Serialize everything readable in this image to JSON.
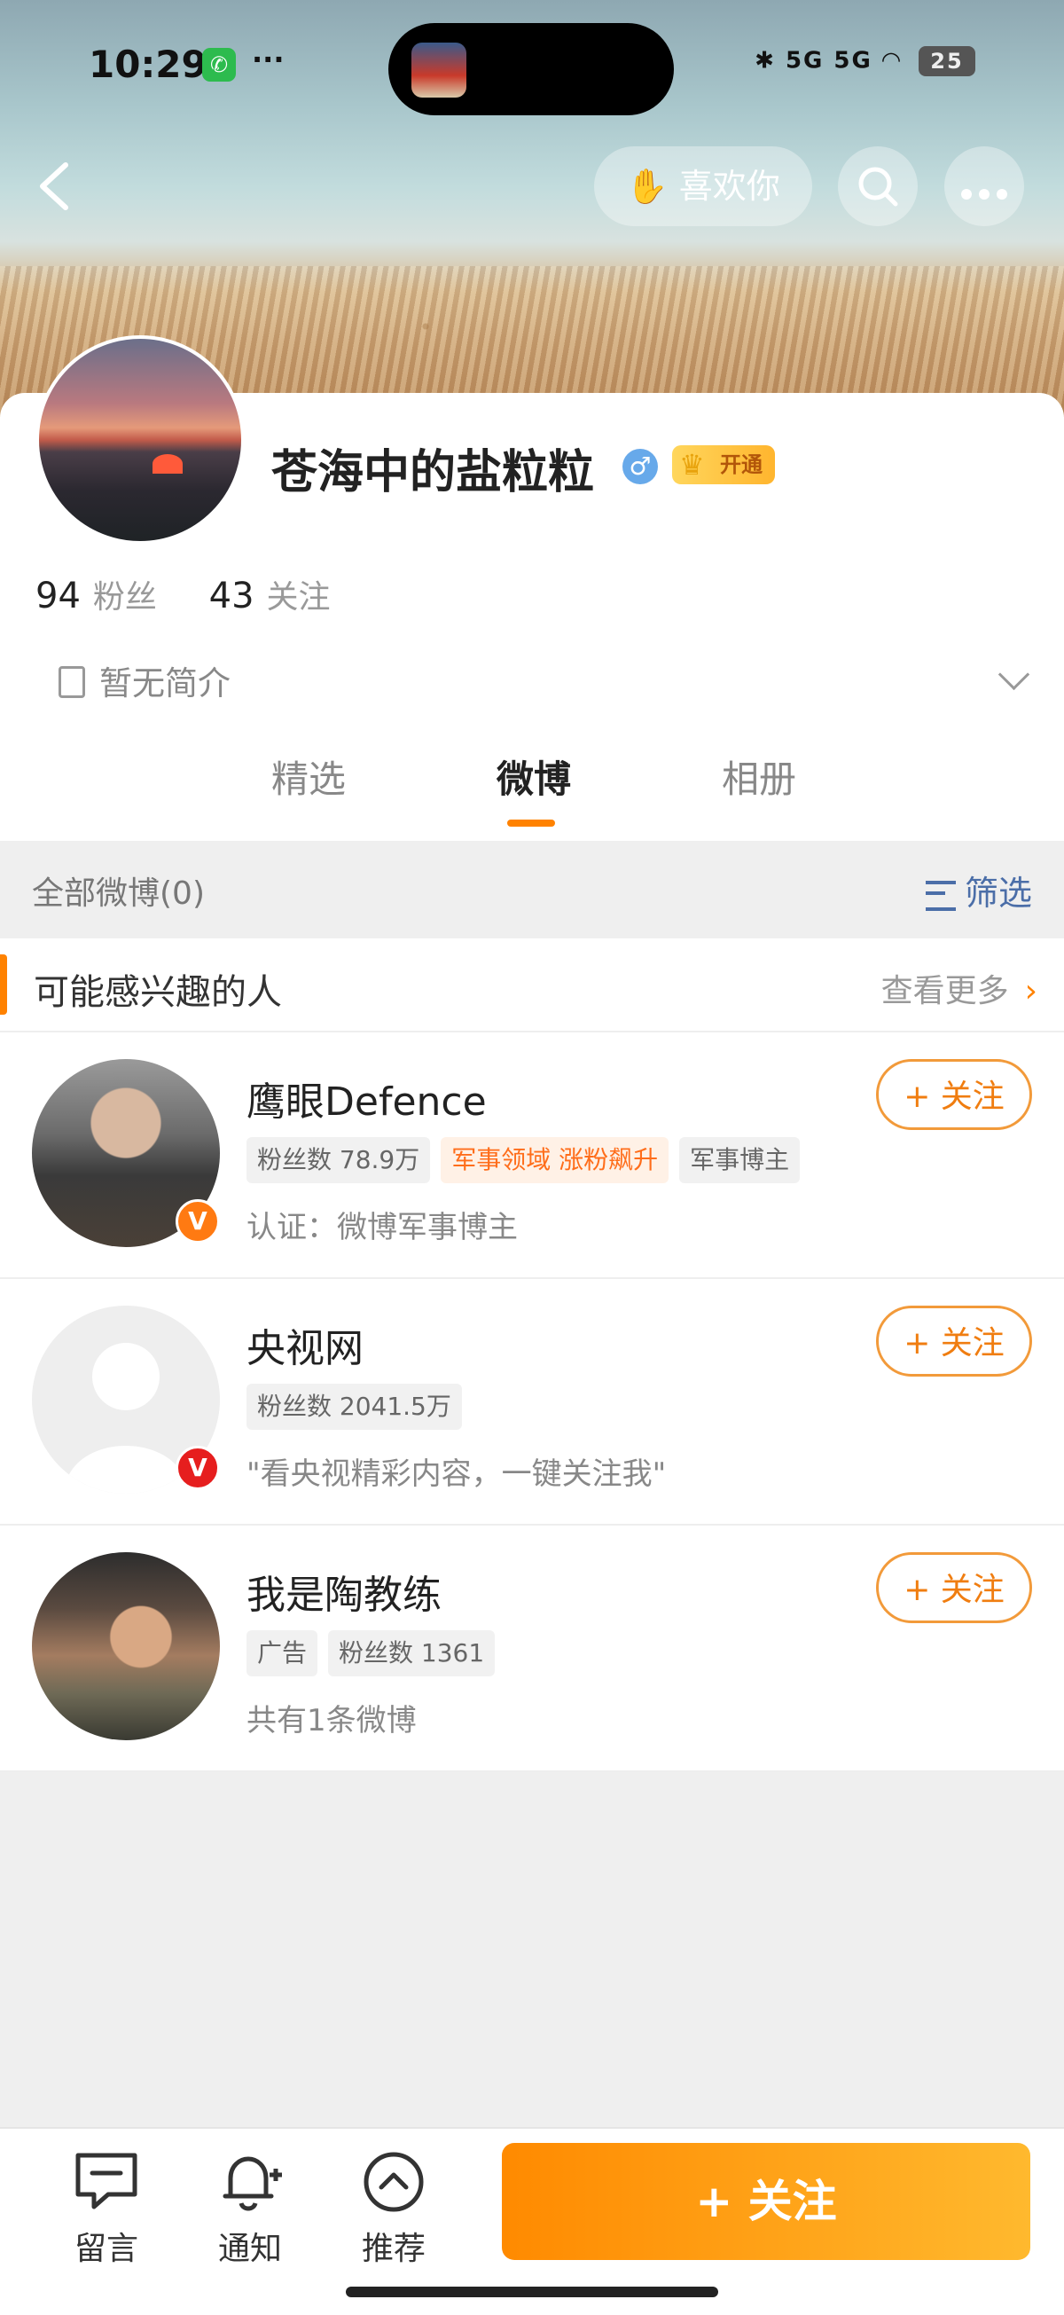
{
  "status_bar": {
    "time": "10:29",
    "dots": "···",
    "signal_text": "5G  5G",
    "battery": "25"
  },
  "header": {
    "like_label": "喜欢你"
  },
  "profile": {
    "username": "苍海中的盐粒粒",
    "gender": "♂",
    "vip_label": "开通",
    "followers_count": "94",
    "followers_label": "粉丝",
    "following_count": "43",
    "following_label": "关注",
    "bio": "暂无简介"
  },
  "tabs": [
    {
      "label": "精选",
      "active": false
    },
    {
      "label": "微博",
      "active": true
    },
    {
      "label": "相册",
      "active": false
    }
  ],
  "feed": {
    "title": "全部微博(0)",
    "filter_label": "筛选"
  },
  "recommend": {
    "title": "可能感兴趣的人",
    "see_more": "查看更多",
    "items": [
      {
        "name": "鹰眼Defence",
        "tags": [
          "粉丝数 78.9万",
          "军事领域 涨粉飙升",
          "军事博主"
        ],
        "desc": "认证：微博军事博主",
        "follow": "+ 关注",
        "verify": "V",
        "verify_color": "#ff7a12"
      },
      {
        "name": "央视网",
        "tags": [
          "粉丝数 2041.5万"
        ],
        "desc": "\"看央视精彩内容，一键关注我\"",
        "follow": "+ 关注",
        "verify": "V",
        "verify_color": "#e61e1e"
      },
      {
        "name": "我是陶教练",
        "tags": [
          "广告",
          "粉丝数 1361"
        ],
        "desc": "共有1条微博",
        "follow": "+ 关注"
      }
    ]
  },
  "bottom_bar": {
    "message_label": "留言",
    "notify_label": "通知",
    "recommend_label": "推荐",
    "follow_label": "+ 关注"
  },
  "colors": {
    "accent": "#ff8200",
    "link": "#4b6ea8",
    "follow_gradient_end": "#ffb92e"
  }
}
